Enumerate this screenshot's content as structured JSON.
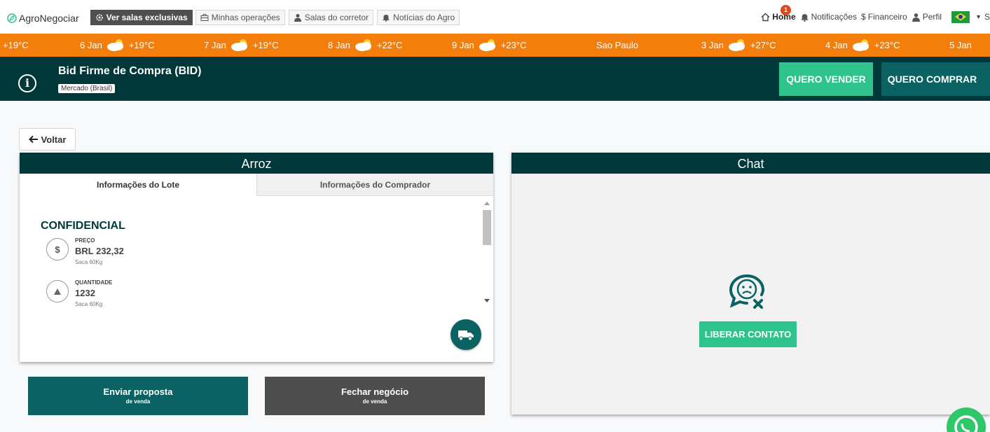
{
  "brand": {
    "name": "AgroNegociar"
  },
  "nav": {
    "exclusive": "Ver salas exclusivas",
    "operations": "Minhas operações",
    "broker": "Salas do corretor",
    "news": "Notícias do Agro",
    "home": "Home",
    "notifications": "Notificações",
    "notifications_count": "1",
    "financial": "Financeiro",
    "profile": "Perfil",
    "more": "S"
  },
  "weather": [
    {
      "date": "",
      "temp": "+19°C"
    },
    {
      "date": "6 Jan",
      "temp": "+19°C"
    },
    {
      "date": "7 Jan",
      "temp": "+19°C"
    },
    {
      "date": "8 Jan",
      "temp": "+22°C"
    },
    {
      "date": "9 Jan",
      "temp": "+23°C"
    },
    {
      "date": "Sao Paulo",
      "temp": ""
    },
    {
      "date": "3 Jan",
      "temp": "+27°C"
    },
    {
      "date": "4 Jan",
      "temp": "+23°C"
    },
    {
      "date": "5 Jan",
      "temp": ""
    }
  ],
  "header": {
    "title": "Bid Firme de Compra (BID)",
    "subtitle": "Mercado (Brasil)",
    "sell": "QUERO VENDER",
    "buy": "QUERO COMPRAR"
  },
  "back": "Voltar",
  "lot": {
    "product": "Arroz",
    "tabs": [
      "Informações do Lote",
      "Informações do Comprador"
    ],
    "confidential": "CONFIDENCIAL",
    "price": {
      "label": "PREÇO",
      "value": "BRL 232,32",
      "unit": "Saca 60Kg"
    },
    "quantity": {
      "label": "QUANTIDADE",
      "value": "1232",
      "unit": "Saca 60Kg"
    }
  },
  "actions": {
    "send": {
      "title": "Enviar proposta",
      "sub": "de venda"
    },
    "close": {
      "title": "Fechar negócio",
      "sub": "de venda"
    }
  },
  "chat": {
    "title": "Chat",
    "release": "LIBERAR CONTATO"
  },
  "colors": {
    "dark": "#003839",
    "teal": "#0a6362",
    "green": "#2ec28c",
    "orange": "#f47e0c"
  }
}
